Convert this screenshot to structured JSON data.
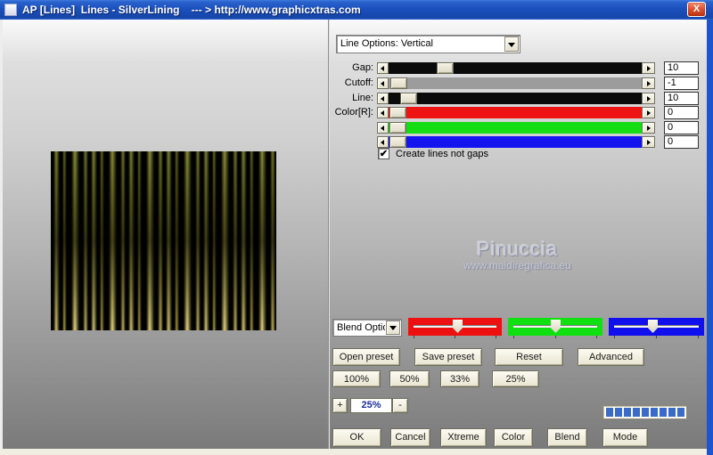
{
  "window": {
    "title": "AP [Lines]  Lines - SilverLining    --- > http://www.graphicxtras.com",
    "close_glyph": "X",
    "titlebar_color": "#1b50bc",
    "frame_color": "#1c55ce"
  },
  "line_options": {
    "value": "Line Options: Vertical"
  },
  "sliders": [
    {
      "label": "Gap:",
      "value": "10",
      "track_color": "#0a0a0a"
    },
    {
      "label": "Cutoff:",
      "value": "-1",
      "track_color": "#9c9c9c"
    },
    {
      "label": "Line:",
      "value": "10",
      "track_color": "#0a0a0a"
    },
    {
      "label": "Color[R]:",
      "value": "0",
      "track_color": "#ee1414"
    },
    {
      "label": "",
      "value": "0",
      "track_color": "#14dd14"
    },
    {
      "label": "",
      "value": "0",
      "track_color": "#1414ee"
    }
  ],
  "checkbox": {
    "label": "Create lines not gaps",
    "checked": true
  },
  "icons": {
    "check": "✔"
  },
  "watermark": {
    "name": "Pinuccia",
    "url": "www.maidiregrafica.eu"
  },
  "blend": {
    "dropdown_value": "Blend Optio",
    "sliders": [
      {
        "name": "red",
        "color": "#ee1010"
      },
      {
        "name": "green",
        "color": "#10e010"
      },
      {
        "name": "blue",
        "color": "#1010ee"
      }
    ]
  },
  "preset_buttons": [
    "Open preset",
    "Save preset",
    "Reset",
    "Advanced"
  ],
  "zoom_buttons": [
    "100%",
    "50%",
    "33%",
    "25%"
  ],
  "stepper": {
    "plus": "+",
    "value": "25%",
    "minus": "-"
  },
  "progress": {
    "segments_filled": 9,
    "segment_color": "#3a6bc8"
  },
  "action_buttons": [
    "OK",
    "Cancel",
    "Xtreme",
    "Color",
    "Blend",
    "Mode"
  ]
}
